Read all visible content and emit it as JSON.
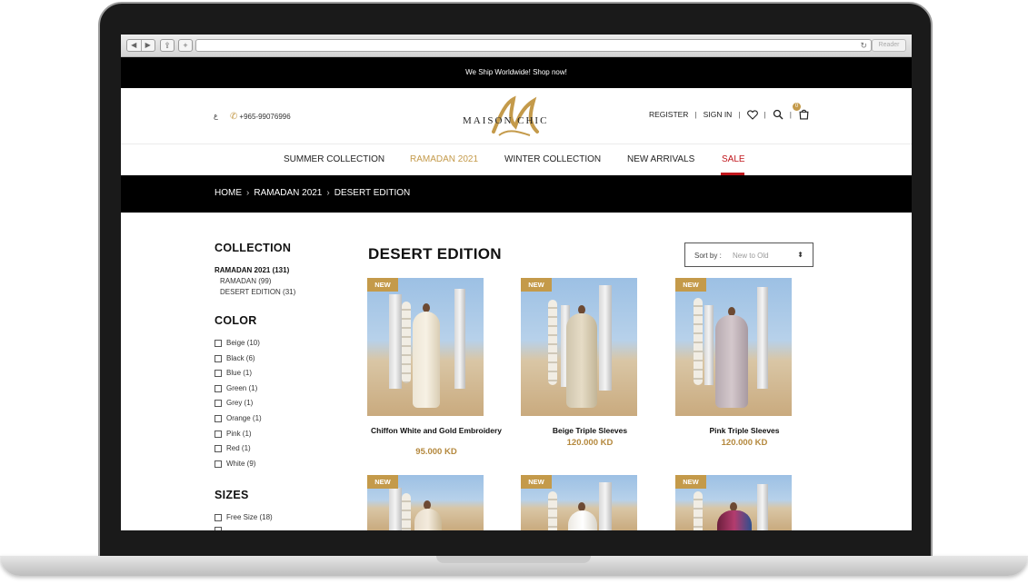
{
  "browser": {
    "reader_label": "Reader",
    "url": ""
  },
  "promo": {
    "text": "We Ship Worldwide! Shop now!"
  },
  "header": {
    "lang": "ع",
    "phone": "+965-99076996",
    "logo_text": "MAISON CHIC",
    "register": "REGISTER",
    "sign_in": "SIGN IN",
    "cart_count": "0"
  },
  "nav": {
    "items": [
      {
        "label": "SUMMER COLLECTION"
      },
      {
        "label": "RAMADAN 2021"
      },
      {
        "label": "WINTER COLLECTION"
      },
      {
        "label": "NEW ARRIVALS"
      },
      {
        "label": "SALE"
      }
    ],
    "active_color": "#c49a4a",
    "sale_color": "#c0161c"
  },
  "breadcrumb": {
    "items": [
      "HOME",
      "RAMADAN 2021",
      "DESERT EDITION"
    ]
  },
  "sidebar": {
    "collection_heading": "COLLECTION",
    "collection_items": [
      "RAMADAN 2021 (131)",
      "RAMADAN (99)",
      "DESERT EDITION (31)"
    ],
    "color_heading": "COLOR",
    "colors": [
      "Beige (10)",
      "Black (6)",
      "Blue (1)",
      "Green (1)",
      "Grey (1)",
      "Orange (1)",
      "Pink (1)",
      "Red (1)",
      "White (9)"
    ],
    "sizes_heading": "SIZES",
    "sizes": [
      "Free Size (18)"
    ]
  },
  "main": {
    "title": "DESERT EDITION",
    "sort_label": "Sort by :",
    "sort_value": "New to Old",
    "badge": "NEW",
    "products": [
      {
        "name": "Chiffon White and Gold Embroidery",
        "price": "95.000 KD"
      },
      {
        "name": "Beige Triple Sleeves",
        "price": "120.000 KD"
      },
      {
        "name": "Pink Triple Sleeves",
        "price": "120.000 KD"
      }
    ]
  },
  "colors": {
    "accent": "#c49a4a",
    "price": "#b4883d",
    "sale": "#c0161c",
    "dark": "#000000"
  }
}
